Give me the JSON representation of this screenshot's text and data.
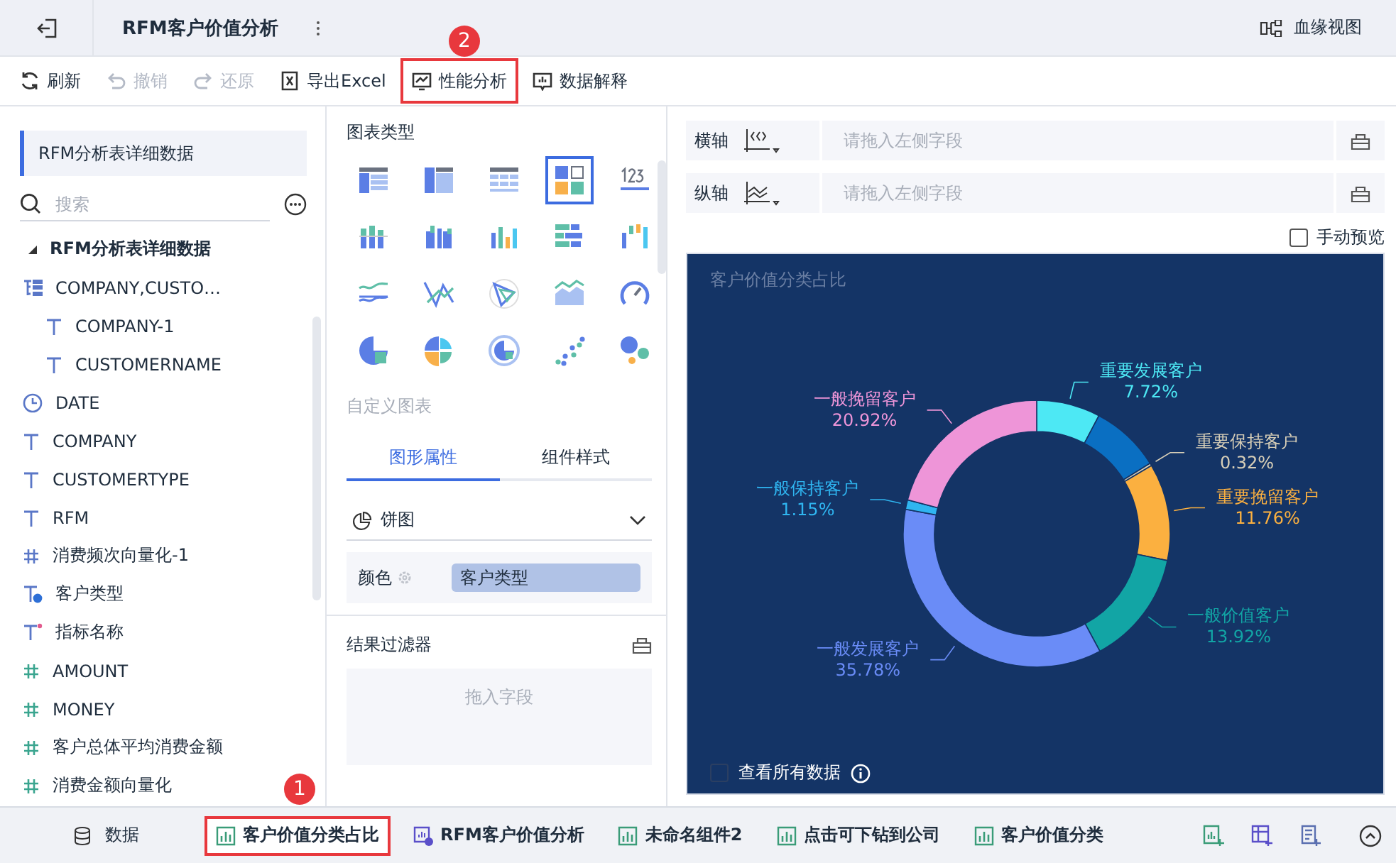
{
  "topbar": {
    "title": "RFM客户价值分析",
    "lineage": "血缘视图"
  },
  "toolbar": [
    {
      "kind": "refresh",
      "label": "刷新",
      "disabled": false,
      "highlighted": false
    },
    {
      "kind": "undo",
      "label": "撤销",
      "disabled": true,
      "highlighted": false
    },
    {
      "kind": "redo",
      "label": "还原",
      "disabled": true,
      "highlighted": false
    },
    {
      "kind": "excel",
      "label": "导出Excel",
      "disabled": false,
      "highlighted": false
    },
    {
      "kind": "performance",
      "label": "性能分析",
      "disabled": false,
      "highlighted": true
    },
    {
      "kind": "explain",
      "label": "数据解释",
      "disabled": false,
      "highlighted": false
    }
  ],
  "callouts": [
    {
      "label": "2",
      "kind": "toolbar"
    },
    {
      "label": "1",
      "kind": "tabs"
    }
  ],
  "sidebar": {
    "dataset": "RFM分析表详细数据",
    "search": {
      "placeholder": "搜索"
    },
    "tree": [
      {
        "label": "RFM分析表详细数据",
        "kind": "folder",
        "expanded": true,
        "children": [
          {
            "label": "COMPANY,CUSTO…",
            "kind": "hierarchy",
            "children": [
              {
                "label": "COMPANY-1",
                "kind": "text"
              },
              {
                "label": "CUSTOMERNAME",
                "kind": "text"
              }
            ]
          },
          {
            "label": "DATE",
            "kind": "date"
          },
          {
            "label": "COMPANY",
            "kind": "text"
          },
          {
            "label": "CUSTOMERTYPE",
            "kind": "text"
          },
          {
            "label": "RFM",
            "kind": "text"
          },
          {
            "label": "消费频次向量化-1",
            "kind": "number"
          },
          {
            "label": "客户类型",
            "kind": "calc-text"
          },
          {
            "label": "指标名称",
            "kind": "param-text"
          },
          {
            "label": "AMOUNT",
            "kind": "measure"
          },
          {
            "label": "MONEY",
            "kind": "measure"
          },
          {
            "label": "客户总体平均消费金额",
            "kind": "measure"
          },
          {
            "label": "消费金额向量化",
            "kind": "measure"
          }
        ]
      }
    ]
  },
  "chart_types": {
    "title": "图表类型",
    "items": [
      {
        "kind": "table",
        "selected": false
      },
      {
        "kind": "cross-table",
        "selected": false
      },
      {
        "kind": "detail-table",
        "selected": false
      },
      {
        "kind": "combo",
        "selected": true
      },
      {
        "kind": "kpi",
        "selected": false
      },
      {
        "kind": "stacked-bar",
        "selected": false
      },
      {
        "kind": "grouped-bar",
        "selected": false
      },
      {
        "kind": "bar",
        "selected": false
      },
      {
        "kind": "horizontal-bar",
        "selected": false
      },
      {
        "kind": "waterfall",
        "selected": false
      },
      {
        "kind": "line",
        "selected": false
      },
      {
        "kind": "cross-line",
        "selected": false
      },
      {
        "kind": "radar",
        "selected": false
      },
      {
        "kind": "area",
        "selected": false
      },
      {
        "kind": "gauge",
        "selected": false
      },
      {
        "kind": "pie",
        "selected": false
      },
      {
        "kind": "rose",
        "selected": false
      },
      {
        "kind": "ring",
        "selected": false
      },
      {
        "kind": "scatter",
        "selected": false
      },
      {
        "kind": "bubble",
        "selected": false
      }
    ],
    "custom": "自定义图表"
  },
  "props_tabs": [
    {
      "label": "图形属性",
      "selected": true
    },
    {
      "label": "组件样式",
      "selected": false
    }
  ],
  "chart_select": {
    "value": "饼图"
  },
  "color_field": {
    "label": "颜色",
    "value": "客户类型"
  },
  "filter": {
    "title": "结果过滤器",
    "placeholder": "拖入字段"
  },
  "axes": [
    {
      "kind": "x",
      "label": "横轴",
      "placeholder": "请拖入左侧字段"
    },
    {
      "kind": "y",
      "label": "纵轴",
      "placeholder": "请拖入左侧字段"
    }
  ],
  "manual_preview": {
    "label": "手动预览",
    "checked": false
  },
  "chart": {
    "chart_data": {
      "type": "donut",
      "title": "客户价值分类占比",
      "categories": [
        "重要发展客户",
        null,
        "重要保持客户",
        "重要挽留客户",
        "一般价值客户",
        "一般发展客户",
        "一般保持客户",
        "一般挽留客户"
      ],
      "values": [
        7.72,
        8.43,
        0.32,
        11.76,
        13.92,
        35.78,
        1.15,
        20.92
      ],
      "value_labels": [
        "7.72%",
        null,
        "0.32%",
        "11.76%",
        "13.92%",
        "35.78%",
        "1.15%",
        "20.92%"
      ],
      "colors": [
        "#4de8f4",
        "#0a6fc2",
        "#d8cfb8",
        "#fbb040",
        "#12a5a5",
        "#6a8cf7",
        "#2fb5f0",
        "#ee95d8"
      ]
    },
    "show_all": {
      "label": "查看所有数据",
      "checked": false
    }
  },
  "bottom": {
    "data_label": "数据",
    "tabs": [
      {
        "kind": "chart",
        "label": "客户价值分类占比",
        "selected": true,
        "highlighted": true
      },
      {
        "kind": "composite",
        "label": "RFM客户价值分析",
        "selected": false,
        "highlighted": false
      },
      {
        "kind": "chart",
        "label": "未命名组件2",
        "selected": false,
        "highlighted": false
      },
      {
        "kind": "chart",
        "label": "点击可下钻到公司",
        "selected": false,
        "highlighted": false
      },
      {
        "kind": "chart",
        "label": "客户价值分类",
        "selected": false,
        "highlighted": false
      }
    ]
  }
}
